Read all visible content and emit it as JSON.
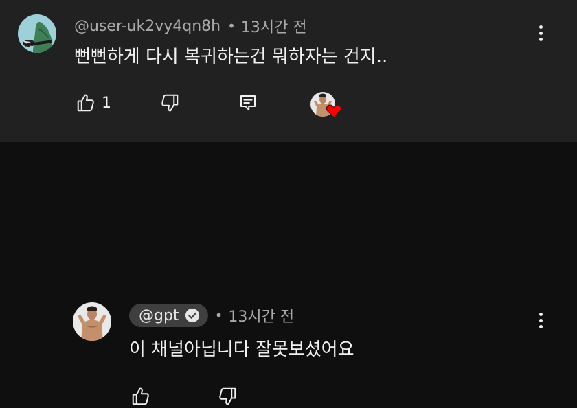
{
  "comments": [
    {
      "handle": "@user-uk2vy4qn8h",
      "separator": "•",
      "time": "13시간 전",
      "text": "뻔뻔하게 다시 복귀하는건 뭐하자는 건지..",
      "like_count": "1",
      "icons": [
        "thumbs-up-icon",
        "thumbs-down-icon",
        "reply-icon",
        "creator-heart-icon",
        "more-vert-icon"
      ]
    },
    {
      "handle": "@gpt",
      "separator": "•",
      "time": "13시간 전",
      "text": "이 채널아닙니다 잘못보셨어요",
      "verified": true,
      "icons": [
        "thumbs-up-icon",
        "thumbs-down-icon",
        "verified-check-icon",
        "more-vert-icon"
      ]
    }
  ],
  "colors": {
    "thread_bg": "#212121",
    "reply_bg": "#0f0f0f",
    "meta_text": "#aaaaaa",
    "heart": "#ff0000",
    "chip": "#3f3f3f"
  }
}
